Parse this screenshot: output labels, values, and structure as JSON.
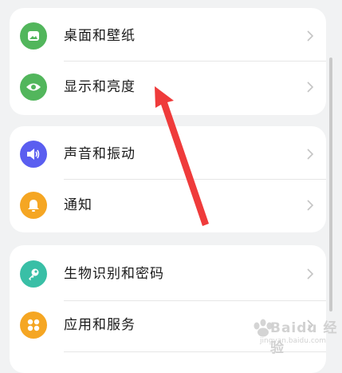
{
  "settings_groups": [
    {
      "items": [
        {
          "label": "桌面和壁纸",
          "icon": "wallpaper-icon",
          "color": "#52b65c"
        },
        {
          "label": "显示和亮度",
          "icon": "eye-icon",
          "color": "#52b65c"
        }
      ]
    },
    {
      "items": [
        {
          "label": "声音和振动",
          "icon": "speaker-icon",
          "color": "#5a5ef0"
        },
        {
          "label": "通知",
          "icon": "bell-icon",
          "color": "#f5a623"
        }
      ]
    },
    {
      "items": [
        {
          "label": "生物识别和密码",
          "icon": "key-icon",
          "color": "#39bfa6"
        },
        {
          "label": "应用和服务",
          "icon": "apps-icon",
          "color": "#f5a623"
        }
      ]
    }
  ],
  "annotation": {
    "arrow_color": "#ef3b3b"
  },
  "watermark": {
    "text": "Baidu 经验",
    "subtext": "jingyan.baidu.com"
  }
}
